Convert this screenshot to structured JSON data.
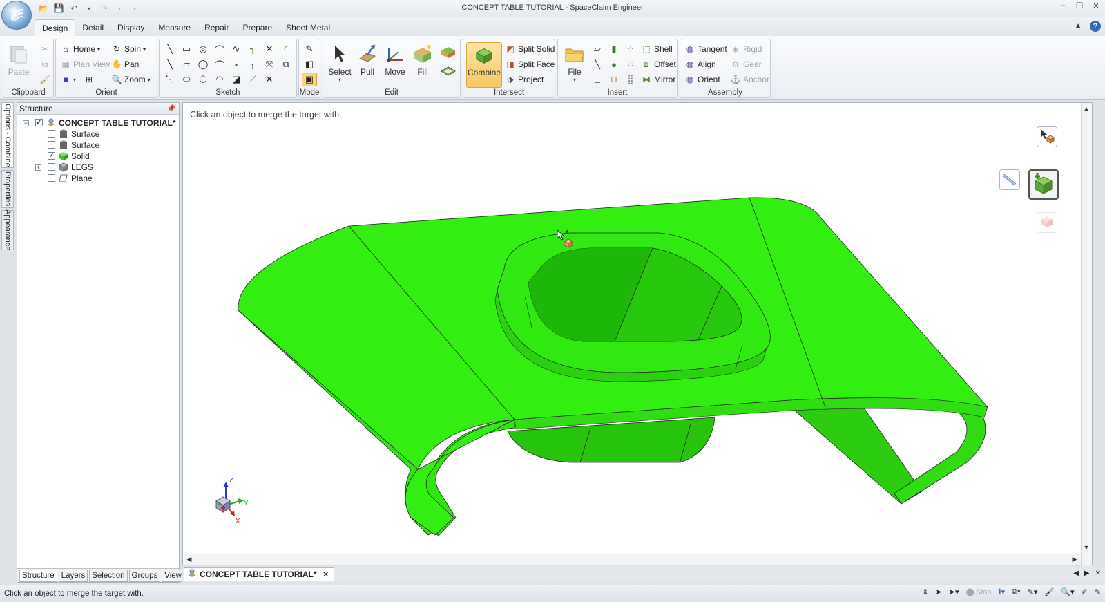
{
  "window": {
    "title": "CONCEPT TABLE TUTORIAL - SpaceClaim Engineer",
    "controls": [
      "minimize-icon",
      "restore-icon",
      "close-icon"
    ]
  },
  "quick_access": [
    "open-icon",
    "save-icon",
    "undo-icon",
    "redo-icon",
    "customize-icon"
  ],
  "ribbon": {
    "tabs": [
      "Design",
      "Detail",
      "Display",
      "Measure",
      "Repair",
      "Prepare",
      "Sheet Metal"
    ],
    "active_tab": "Design",
    "groups": {
      "clipboard": {
        "label": "Clipboard",
        "paste": "Paste"
      },
      "orient": {
        "label": "Orient",
        "home": "Home",
        "spin": "Spin",
        "plan_view": "Plan View",
        "pan": "Pan",
        "zoom": "Zoom"
      },
      "sketch": {
        "label": "Sketch"
      },
      "mode": {
        "label": "Mode"
      },
      "edit": {
        "label": "Edit",
        "select": "Select",
        "pull": "Pull",
        "move": "Move",
        "fill": "Fill"
      },
      "intersect": {
        "label": "Intersect",
        "combine": "Combine",
        "split_solid": "Split Solid",
        "split_face": "Split Face",
        "project": "Project"
      },
      "insert": {
        "label": "Insert",
        "file": "File",
        "shell": "Shell",
        "offset": "Offset",
        "mirror": "Mirror"
      },
      "assembly": {
        "label": "Assembly",
        "tangent": "Tangent",
        "align": "Align",
        "orient": "Orient",
        "rigid": "Rigid",
        "gear": "Gear",
        "anchor": "Anchor"
      }
    }
  },
  "side_tabs": [
    "Options - Combine",
    "Properties",
    "Appearance"
  ],
  "structure": {
    "title": "Structure",
    "tree": [
      {
        "label": "CONCEPT TABLE TUTORIAL*",
        "checked": true,
        "expander": "−",
        "icon": "document-icon"
      },
      {
        "label": "Surface",
        "checked": false,
        "icon": "surface-icon"
      },
      {
        "label": "Surface",
        "checked": false,
        "icon": "surface-icon"
      },
      {
        "label": "Solid",
        "checked": true,
        "icon": "solid-icon"
      },
      {
        "label": "LEGS",
        "checked": false,
        "expander": "+",
        "icon": "component-icon"
      },
      {
        "label": "Plane",
        "checked": false,
        "icon": "plane-icon"
      }
    ],
    "panel_tabs": [
      "Structure",
      "Layers",
      "Selection",
      "Groups",
      "Views"
    ],
    "active_panel_tab": "Structure"
  },
  "viewport": {
    "hint": "Click an object to merge the target with.",
    "model_color": "#33ee11",
    "axis_labels": {
      "z": "Z",
      "y": "Y",
      "x": "X"
    }
  },
  "document_tab": {
    "label": "CONCEPT TABLE TUTORIAL*"
  },
  "status": {
    "text": "Click an object to merge the target with.",
    "stop": "Stop"
  }
}
